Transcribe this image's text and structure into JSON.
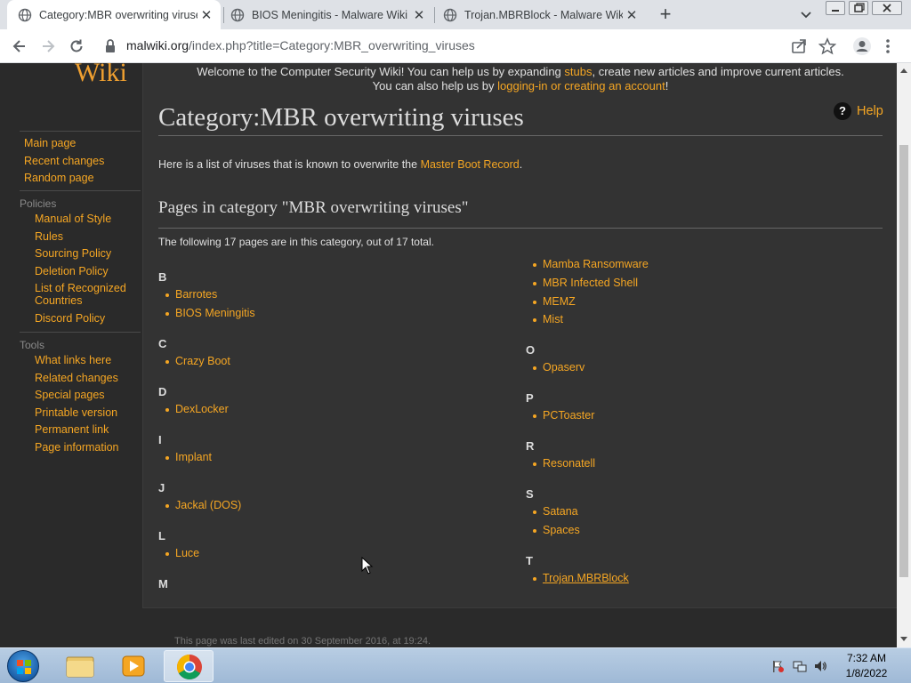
{
  "browser": {
    "tabs": [
      {
        "title": "Category:MBR overwriting viruses",
        "active": true
      },
      {
        "title": "BIOS Meningitis - Malware Wiki",
        "active": false
      },
      {
        "title": "Trojan.MBRBlock - Malware Wiki",
        "active": false
      }
    ],
    "url_host": "malwiki.org",
    "url_path": "/index.php?title=Category:MBR_overwriting_viruses"
  },
  "logo": {
    "text": "Wiki"
  },
  "sidebar": {
    "navigation": [
      "Main page",
      "Recent changes",
      "Random page"
    ],
    "policies_header": "Policies",
    "policies": [
      "Manual of Style",
      "Rules",
      "Sourcing Policy",
      "Deletion Policy",
      "List of Recognized Countries",
      "Discord Policy"
    ],
    "tools_header": "Tools",
    "tools": [
      "What links here",
      "Related changes",
      "Special pages",
      "Printable version",
      "Permanent link",
      "Page information"
    ]
  },
  "notice": {
    "line1_a": "Welcome to the Computer Security Wiki! You can help us by expanding ",
    "line1_link": "stubs",
    "line1_b": ", create new articles and improve current articles.",
    "line2_a": "You can also help us by ",
    "line2_link": "logging-in or creating an account",
    "line2_b": "!"
  },
  "page": {
    "title": "Category:MBR overwriting viruses",
    "help": "Help",
    "intro_text": "Here is a list of viruses that is known to overwrite the ",
    "intro_link": "Master Boot Record",
    "intro_end": ".",
    "category_heading": "Pages in category \"MBR overwriting viruses\"",
    "count_text": "The following 17 pages are in this category, out of 17 total."
  },
  "letters": [
    "B",
    "C",
    "D",
    "I",
    "J",
    "L",
    "M",
    "O",
    "P",
    "R",
    "S",
    "T"
  ],
  "pages": [
    "Barrotes",
    "BIOS Meningitis",
    "Crazy Boot",
    "DexLocker",
    "Implant",
    "Jackal (DOS)",
    "Luce",
    "Mamba Ransomware",
    "MBR Infected Shell",
    "MEMZ",
    "Mist",
    "Opaserv",
    "PCToaster",
    "Resonatell",
    "Satana",
    "Spaces",
    "Trojan.MBRBlock"
  ],
  "footer": "This page was last edited on 30 September 2016, at 19:24.",
  "taskbar": {
    "time": "7:32 AM",
    "date": "1/8/2022"
  }
}
